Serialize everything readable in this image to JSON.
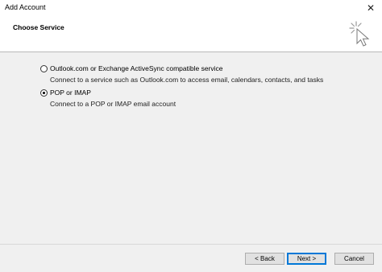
{
  "window": {
    "title": "Add Account",
    "close_glyph": "✕"
  },
  "header": {
    "title": "Choose Service",
    "icon": "wizard-cursor-icon"
  },
  "options": [
    {
      "label": "Outlook.com or Exchange ActiveSync compatible service",
      "description": "Connect to a service such as Outlook.com to access email, calendars, contacts, and tasks",
      "selected": false
    },
    {
      "label": "POP or IMAP",
      "description": "Connect to a POP or IMAP email account",
      "selected": true
    }
  ],
  "buttons": {
    "back": "< Back",
    "next": "Next >",
    "cancel": "Cancel"
  },
  "colors": {
    "accent": "#0078d7",
    "dialog_bg": "#f0f0f0",
    "header_bg": "#ffffff"
  }
}
